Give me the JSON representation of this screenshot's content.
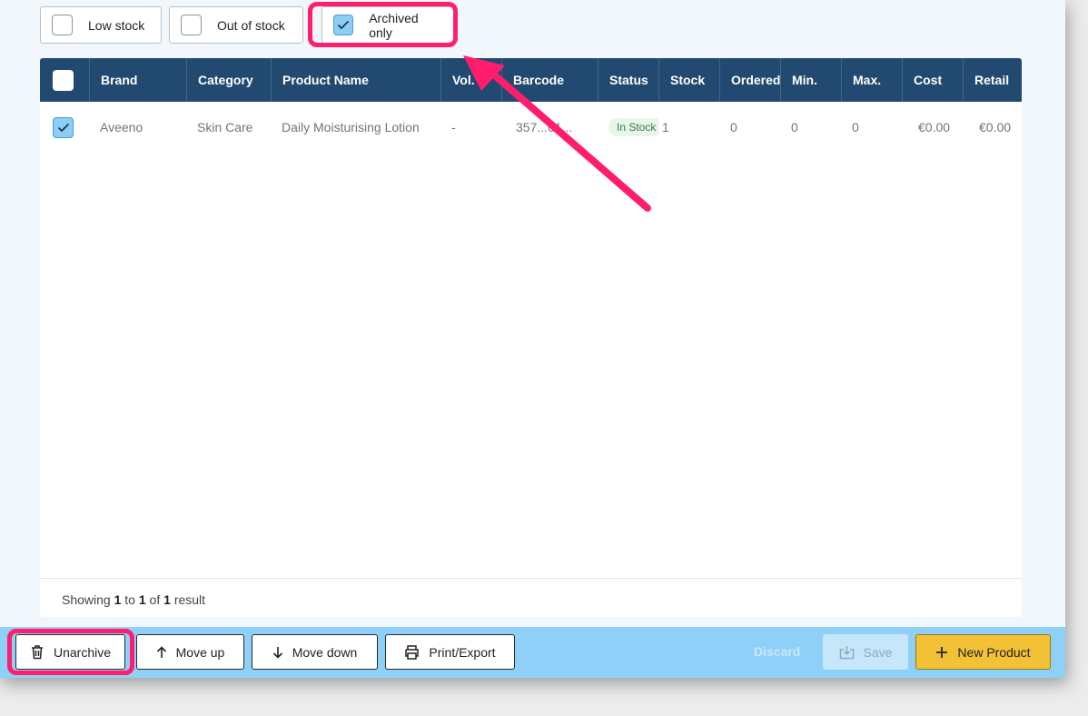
{
  "filters": {
    "low_stock": "Low stock",
    "out_of_stock": "Out of stock",
    "archived_only": "Archived only"
  },
  "table": {
    "columns": [
      "Brand",
      "Category",
      "Product Name",
      "Vol.",
      "Barcode",
      "Status",
      "Stock",
      "Ordered",
      "Min.",
      "Max.",
      "Cost",
      "Retail"
    ],
    "rows": [
      {
        "brand": "Aveeno",
        "category": "Skin Care",
        "product_name": "Daily Moisturising Lotion",
        "vol": "-",
        "barcode": "357...61...",
        "status": "In Stock",
        "stock": "1",
        "ordered": "0",
        "min": "0",
        "max": "0",
        "cost": "€0.00",
        "retail": "€0.00"
      }
    ]
  },
  "pagination": {
    "showing": "Showing",
    "from": "1",
    "to_word": "to",
    "to": "1",
    "of_word": "of",
    "total": "1",
    "result_word": "result"
  },
  "actions": {
    "unarchive": "Unarchive",
    "move_up": "Move up",
    "move_down": "Move down",
    "print_export": "Print/Export",
    "discard": "Discard",
    "save": "Save",
    "new_product": "New Product"
  },
  "colors": {
    "header_bg": "#224a70",
    "action_bar": "#8fd0f8",
    "highlight": "#ff1d6c",
    "primary_button": "#f2c135"
  }
}
